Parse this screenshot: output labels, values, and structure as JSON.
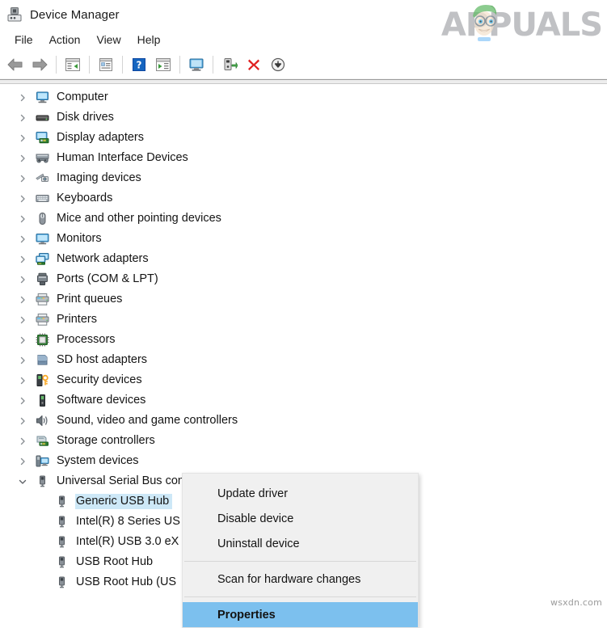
{
  "window": {
    "title": "Device Manager",
    "icon": "device-manager-icon"
  },
  "branding": {
    "logo_text": "APPUALS",
    "logo_color": "#8d9094",
    "bottom_watermark": "wsxdn.com"
  },
  "menubar": {
    "items": [
      {
        "label": "File"
      },
      {
        "label": "Action"
      },
      {
        "label": "View"
      },
      {
        "label": "Help"
      }
    ]
  },
  "toolbar": {
    "buttons": [
      {
        "name": "back-arrow-icon",
        "title": "Back"
      },
      {
        "name": "forward-arrow-icon",
        "title": "Forward"
      },
      {
        "name": "show-hide-console-tree-icon",
        "title": "Show/Hide Console Tree"
      },
      {
        "name": "properties-icon",
        "title": "Properties"
      },
      {
        "name": "help-icon",
        "title": "Help"
      },
      {
        "name": "show-hide-action-pane-icon",
        "title": "Show/Hide Action Pane"
      },
      {
        "name": "scan-hardware-changes-icon",
        "title": "Scan for hardware changes"
      },
      {
        "name": "update-driver-icon",
        "title": "Update driver"
      },
      {
        "name": "uninstall-device-icon",
        "title": "Uninstall device"
      },
      {
        "name": "disable-device-icon",
        "title": "Disable device"
      }
    ]
  },
  "tree": {
    "items": [
      {
        "label": "Computer",
        "icon": "computer-icon",
        "expanded": false,
        "child": false
      },
      {
        "label": "Disk drives",
        "icon": "disk-drive-icon",
        "expanded": false,
        "child": false
      },
      {
        "label": "Display adapters",
        "icon": "display-adapter-icon",
        "expanded": false,
        "child": false
      },
      {
        "label": "Human Interface Devices",
        "icon": "hid-icon",
        "expanded": false,
        "child": false
      },
      {
        "label": "Imaging devices",
        "icon": "imaging-device-icon",
        "expanded": false,
        "child": false
      },
      {
        "label": "Keyboards",
        "icon": "keyboard-icon",
        "expanded": false,
        "child": false
      },
      {
        "label": "Mice and other pointing devices",
        "icon": "mouse-icon",
        "expanded": false,
        "child": false
      },
      {
        "label": "Monitors",
        "icon": "monitor-icon",
        "expanded": false,
        "child": false
      },
      {
        "label": "Network adapters",
        "icon": "network-adapter-icon",
        "expanded": false,
        "child": false
      },
      {
        "label": "Ports (COM & LPT)",
        "icon": "port-icon",
        "expanded": false,
        "child": false
      },
      {
        "label": "Print queues",
        "icon": "printer-icon",
        "expanded": false,
        "child": false
      },
      {
        "label": "Printers",
        "icon": "printer-icon",
        "expanded": false,
        "child": false
      },
      {
        "label": "Processors",
        "icon": "processor-icon",
        "expanded": false,
        "child": false
      },
      {
        "label": "SD host adapters",
        "icon": "sd-host-adapter-icon",
        "expanded": false,
        "child": false
      },
      {
        "label": "Security devices",
        "icon": "security-device-icon",
        "expanded": false,
        "child": false
      },
      {
        "label": "Software devices",
        "icon": "software-device-icon",
        "expanded": false,
        "child": false
      },
      {
        "label": "Sound, video and game controllers",
        "icon": "sound-device-icon",
        "expanded": false,
        "child": false
      },
      {
        "label": "Storage controllers",
        "icon": "storage-controller-icon",
        "expanded": false,
        "child": false
      },
      {
        "label": "System devices",
        "icon": "system-device-icon",
        "expanded": false,
        "child": false
      },
      {
        "label": "Universal Serial Bus controllers",
        "icon": "usb-icon",
        "expanded": true,
        "child": false
      },
      {
        "label": "Generic USB Hub",
        "icon": "usb-icon",
        "child": true,
        "selected": true
      },
      {
        "label": "Intel(R) 8 Series US",
        "icon": "usb-icon",
        "child": true
      },
      {
        "label": "Intel(R) USB 3.0 eX",
        "icon": "usb-icon",
        "child": true
      },
      {
        "label": "USB Root Hub",
        "icon": "usb-icon",
        "child": true
      },
      {
        "label": "USB Root Hub (US",
        "icon": "usb-icon",
        "child": true
      }
    ]
  },
  "context_menu": {
    "items": [
      {
        "label": "Update driver",
        "type": "item"
      },
      {
        "label": "Disable device",
        "type": "item"
      },
      {
        "label": "Uninstall device",
        "type": "item"
      },
      {
        "type": "separator"
      },
      {
        "label": "Scan for hardware changes",
        "type": "item"
      },
      {
        "type": "separator"
      },
      {
        "label": "Properties",
        "type": "item",
        "highlighted": true
      }
    ],
    "highlight_color": "#7cc0ee"
  },
  "colors": {
    "selection": "#cde8f7",
    "menu_background": "#f0f0f0",
    "window_background": "#ffffff"
  }
}
